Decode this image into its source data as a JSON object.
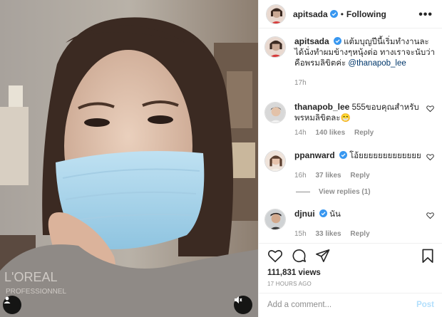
{
  "header": {
    "username": "apitsada",
    "dot": "•",
    "follow_status": "Following",
    "more_label": "•••"
  },
  "caption": {
    "username": "apitsada",
    "text": "แต้มบุญปีนี้เริ่มทำงานละ ได้นั่งทำผมข้างๆหนุ้งต่อ ทางเราจะนับว่าคือพรมลิขิตค่ะ",
    "mention": "@thanapob_lee",
    "time": "17h"
  },
  "comments": [
    {
      "username": "thanapob_lee",
      "text": "555ขอบคุณสำหรับพรหมลิขิตละ😁",
      "time": "14h",
      "likes": "140 likes",
      "reply": "Reply"
    },
    {
      "username": "ppanward",
      "text": "โอ้ยยยยยยยยยยยยย",
      "time": "16h",
      "likes": "37 likes",
      "reply": "Reply"
    },
    {
      "username": "djnui",
      "text": "นัน",
      "time": "15h",
      "likes": "33 likes",
      "reply": "Reply"
    }
  ],
  "view_replies": "View replies (1)",
  "stats": {
    "views": "111,831 views",
    "ago": "17 HOURS AGO"
  },
  "add_comment": {
    "placeholder": "Add a comment...",
    "post_label": "Post"
  },
  "colors": {
    "verified": "#3897f0",
    "link": "#00376b",
    "muted": "#8e8e8e",
    "post_disabled": "#b2dffc"
  }
}
